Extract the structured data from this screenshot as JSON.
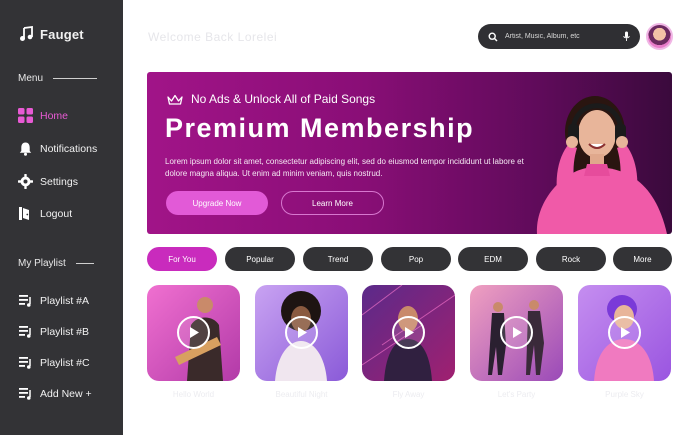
{
  "app": {
    "name": "Fauget"
  },
  "sidebar": {
    "menu_label": "Menu",
    "menu_items": [
      {
        "label": "Home",
        "icon": "grid-icon",
        "active": true
      },
      {
        "label": "Notifications",
        "icon": "bell-icon",
        "active": false
      },
      {
        "label": "Settings",
        "icon": "gear-icon",
        "active": false
      },
      {
        "label": "Logout",
        "icon": "logout-icon",
        "active": false
      }
    ],
    "playlist_label": "My Playlist",
    "playlist_items": [
      {
        "label": "Playlist #A",
        "icon": "playlist-icon"
      },
      {
        "label": "Playlist #B",
        "icon": "playlist-icon"
      },
      {
        "label": "Playlist #C",
        "icon": "playlist-icon"
      },
      {
        "label": "Add New +",
        "icon": "playlist-icon"
      }
    ]
  },
  "header": {
    "greeting": "Welcome Back Lorelei",
    "search_placeholder": "Artist, Music, Album, etc"
  },
  "banner": {
    "tagline": "No Ads & Unlock All of Paid Songs",
    "title": "Premium Membership",
    "description": "Lorem ipsum dolor sit amet, consectetur adipiscing elit, sed do eiusmod tempor incididunt ut labore et dolore magna aliqua. Ut enim ad minim veniam, quis nostrud.",
    "primary_button": "Upgrade Now",
    "secondary_button": "Learn More"
  },
  "genres": [
    {
      "label": "For You",
      "active": true
    },
    {
      "label": "Popular",
      "active": false
    },
    {
      "label": "Trend",
      "active": false
    },
    {
      "label": "Pop",
      "active": false
    },
    {
      "label": "EDM",
      "active": false
    },
    {
      "label": "Rock",
      "active": false
    },
    {
      "label": "More",
      "active": false
    }
  ],
  "songs": [
    {
      "caption": "Hello World"
    },
    {
      "caption": "Beautiful Night"
    },
    {
      "caption": "Fly Away"
    },
    {
      "caption": "Let's Party"
    },
    {
      "caption": "Purple Sky"
    }
  ],
  "colors": {
    "sidebar_bg": "#333336",
    "accent": "#e25ad7",
    "active_nav": "#e85ad4",
    "chip_bg": "#333336",
    "chip_active": "#c92bbd",
    "banner_start": "#a11488",
    "banner_end": "#3a0a3c"
  }
}
